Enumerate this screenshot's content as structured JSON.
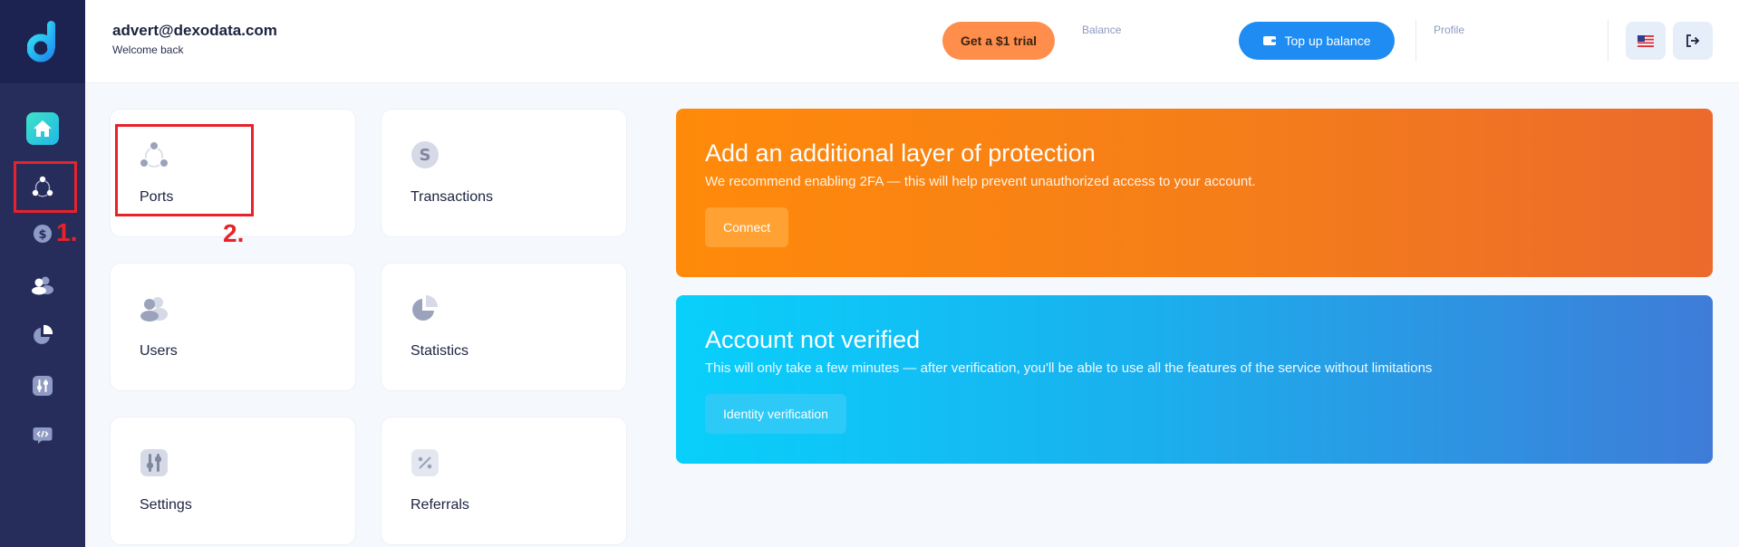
{
  "header": {
    "email": "advert@dexodata.com",
    "welcome": "Welcome back",
    "trial_label": "Get a $1 trial",
    "balance_label": "Balance",
    "topup_label": "Top up balance",
    "profile_label": "Profile"
  },
  "sidebar": {
    "items": [
      {
        "icon": "home-icon"
      },
      {
        "icon": "ports-icon"
      },
      {
        "icon": "dollar-icon"
      },
      {
        "icon": "users-icon"
      },
      {
        "icon": "pie-chart-icon"
      },
      {
        "icon": "settings-sliders-icon"
      },
      {
        "icon": "api-code-icon"
      }
    ]
  },
  "tiles": [
    {
      "label": "Ports",
      "icon": "ports-icon"
    },
    {
      "label": "Transactions",
      "icon": "dollar-icon"
    },
    {
      "label": "Users",
      "icon": "users-icon"
    },
    {
      "label": "Statistics",
      "icon": "pie-chart-icon"
    },
    {
      "label": "Settings",
      "icon": "settings-sliders-icon"
    },
    {
      "label": "Referrals",
      "icon": "percent-icon"
    }
  ],
  "banners": {
    "protection": {
      "title": "Add an additional layer of protection",
      "text": "We recommend enabling 2FA — this will help prevent unauthorized access to your account.",
      "button": "Connect"
    },
    "verification": {
      "title": "Account not verified",
      "text": "This will only take a few minutes — after verification, you'll be able to use all the features of the service without limitations",
      "button": "Identity verification"
    }
  },
  "annotations": {
    "step1": "1.",
    "step2": "2."
  },
  "colors": {
    "sidebar": "#262d5b",
    "accent_orange": "#ff8d4b",
    "accent_blue": "#1e8cf3",
    "annotation_red": "#e8222b"
  }
}
